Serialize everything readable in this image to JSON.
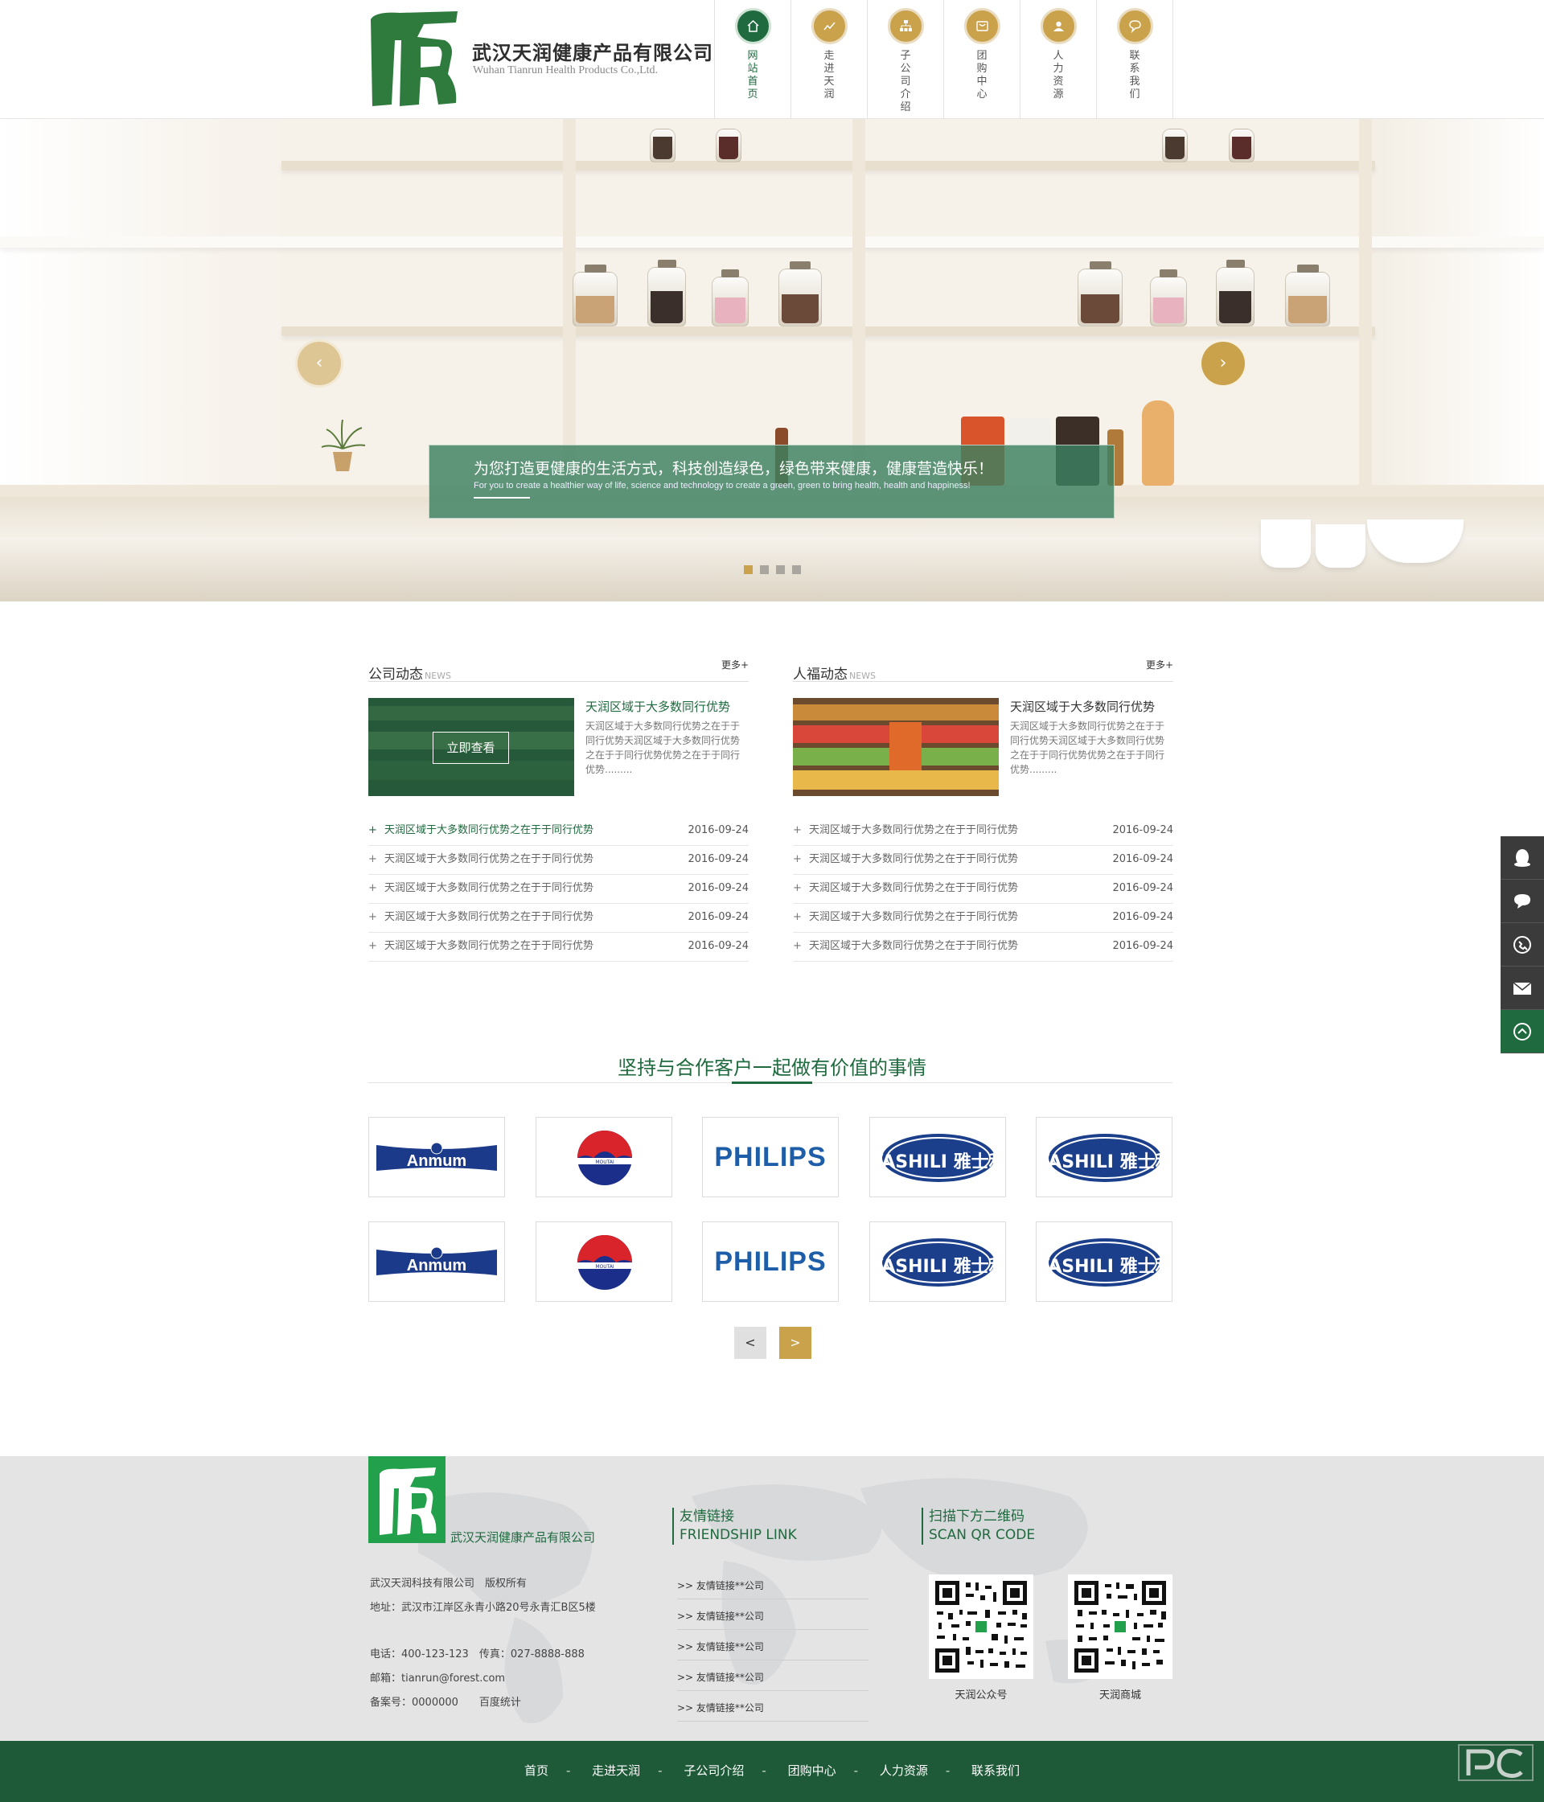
{
  "header": {
    "company_cn": "武汉天润健康产品有限公司",
    "company_en": "Wuhan Tianrun Health Products Co.,Ltd.",
    "nav": [
      {
        "label": "网站首页",
        "icon": "home-icon",
        "active": true
      },
      {
        "label": "走进天润",
        "icon": "chart-icon",
        "active": false
      },
      {
        "label": "子公司介绍",
        "icon": "org-icon",
        "active": false
      },
      {
        "label": "团购中心",
        "icon": "cart-icon",
        "active": false
      },
      {
        "label": "人力资源",
        "icon": "user-icon",
        "active": false
      },
      {
        "label": "联系我们",
        "icon": "chat-icon",
        "active": false
      }
    ]
  },
  "banner": {
    "caption_cn": "为您打造更健康的生活方式，科技创造绿色，绿色带来健康，健康营造快乐！",
    "caption_en": "For you to create a healthier way of life, science and technology to create a green, green to bring health, health and happiness!",
    "prev_icon": "‹",
    "next_icon": "›",
    "slides": 4,
    "active_slide": 1
  },
  "news_left": {
    "title": "公司动态",
    "title_en": "NEWS",
    "more": "更多+",
    "button": "立即查看",
    "feat_title": "天润区域于大多数同行优势",
    "feat_desc": "天润区域于大多数同行优势之在于于同行优势天润区域于大多数同行优势之在于于同行优势优势之在于于同行优势.........",
    "items": [
      {
        "text": "天润区域于大多数同行优势之在于于同行优势",
        "date": "2016-09-24"
      },
      {
        "text": "天润区域于大多数同行优势之在于于同行优势",
        "date": "2016-09-24"
      },
      {
        "text": "天润区域于大多数同行优势之在于于同行优势",
        "date": "2016-09-24"
      },
      {
        "text": "天润区域于大多数同行优势之在于于同行优势",
        "date": "2016-09-24"
      },
      {
        "text": "天润区域于大多数同行优势之在于于同行优势",
        "date": "2016-09-24"
      }
    ]
  },
  "news_right": {
    "title": "人福动态",
    "title_en": "NEWS",
    "more": "更多+",
    "feat_title": "天润区域于大多数同行优势",
    "feat_desc": "天润区域于大多数同行优势之在于于同行优势天润区域于大多数同行优势之在于于同行优势优势之在于于同行优势.........",
    "items": [
      {
        "text": "天润区域于大多数同行优势之在于于同行优势",
        "date": "2016-09-24"
      },
      {
        "text": "天润区域于大多数同行优势之在于于同行优势",
        "date": "2016-09-24"
      },
      {
        "text": "天润区域于大多数同行优势之在于于同行优势",
        "date": "2016-09-24"
      },
      {
        "text": "天润区域于大多数同行优势之在于于同行优势",
        "date": "2016-09-24"
      },
      {
        "text": "天润区域于大多数同行优势之在于于同行优势",
        "date": "2016-09-24"
      }
    ]
  },
  "partners": {
    "title": "坚持与合作客户一起做有价值的事情",
    "logos": [
      "Anmum",
      "MOUTAI",
      "PHILIPS",
      "YASHILI 雅士利",
      "YASHILI 雅士利",
      "Anmum",
      "MOUTAI",
      "PHILIPS",
      "YASHILI 雅士利",
      "YASHILI 雅士利"
    ],
    "prev": "<",
    "next": ">"
  },
  "footer": {
    "company": "武汉天润健康产品有限公司",
    "copyright": "武汉天润科技有限公司　版权所有",
    "address": "地址：武汉市江岸区永青小路20号永青汇B区5楼",
    "phone": "电话：400-123-123　传真：027-8888-888",
    "email": "邮箱：tianrun@forest.com",
    "icp": "备案号：0000000　　百度统计",
    "links_title_cn": "友情链接",
    "links_title_en": "FRIENDSHIP LINK",
    "links": [
      ">> 友情链接**公司",
      ">> 友情链接**公司",
      ">> 友情链接**公司",
      ">> 友情链接**公司",
      ">> 友情链接**公司"
    ],
    "qr_title_cn": "扫描下方二维码",
    "qr_title_en": "SCAN QR CODE",
    "qr": [
      "天润公众号",
      "天润商城"
    ],
    "bottom_nav": [
      "首页",
      "走进天润",
      "子公司介绍",
      "团购中心",
      "人力资源",
      "联系我们"
    ]
  },
  "side_tools": [
    "qq-icon",
    "chat-bubble-icon",
    "phone-icon",
    "mail-icon",
    "back-to-top-icon"
  ],
  "colors": {
    "primary_green": "#1f6a3e",
    "gold": "#c9a24b"
  }
}
